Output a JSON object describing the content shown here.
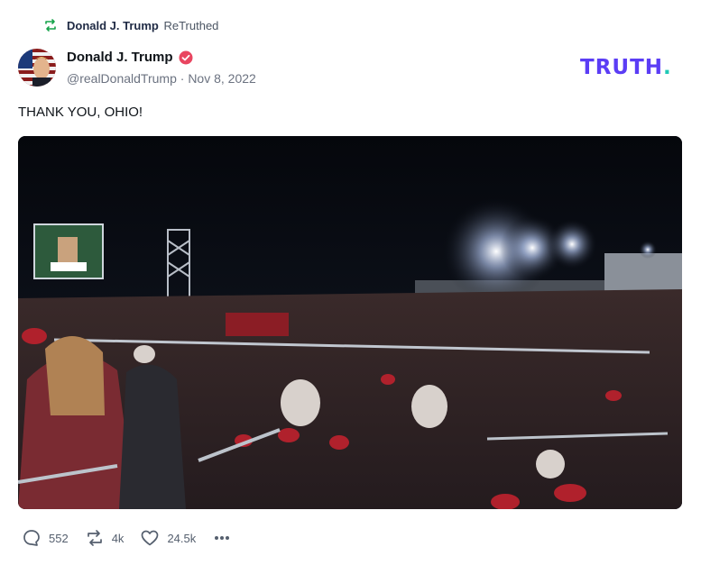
{
  "retruth": {
    "user": "Donald J. Trump",
    "label": "ReTruthed"
  },
  "author": {
    "name": "Donald J. Trump",
    "handle": "@realDonaldTrump",
    "date": "Nov 8, 2022"
  },
  "brand": {
    "text": "TRUTH",
    "dot": "."
  },
  "post": {
    "text": "THANK YOU, OHIO!"
  },
  "media": {
    "description_icon": "rally-photo"
  },
  "actions": {
    "replies": "552",
    "retruths": "4k",
    "likes": "24.5k"
  },
  "icons": {
    "retruth": "retruth-icon",
    "verified": "verified-icon",
    "reply": "reply-icon",
    "like": "heart-icon",
    "more": "more-icon"
  },
  "colors": {
    "brand": "#5b3df5",
    "brand_dot": "#1fc9b6",
    "retruth_green": "#16a34a",
    "verified": "#e94560"
  }
}
